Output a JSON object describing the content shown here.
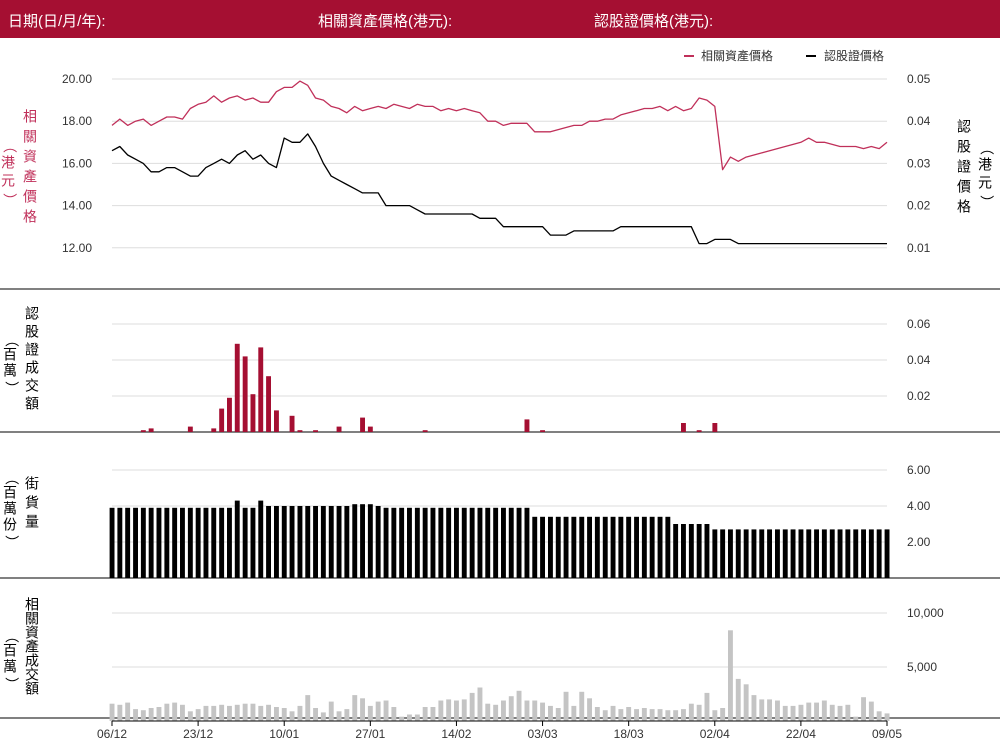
{
  "header": {
    "date_label": "日期(日/月/年):",
    "asset_price_label": "相關資產價格(港元):",
    "warrant_price_label": "認股證價格(港元):"
  },
  "colors": {
    "brand": "#a50f32",
    "asset_line": "#c0305a",
    "warrant_line": "#000000",
    "turnover_bar": "#a50f32",
    "outstanding_bar": "#000000",
    "asset_turnover_bar": "#c4c4c4",
    "grid": "#dddddd"
  },
  "chart_data": {
    "x_tick_labels": [
      "06/12",
      "23/12",
      "10/01",
      "27/01",
      "14/02",
      "03/03",
      "18/03",
      "02/04",
      "22/04",
      "09/05"
    ],
    "panels": [
      {
        "name": "price",
        "type": "line",
        "legend": [
          "相關資產價格",
          "認股證價格"
        ],
        "legend_position": "top-right",
        "left_axis_label": "相關資產價格（港元）",
        "right_axis_label": "認股證價格（港元）",
        "left_ticks": [
          "20.00",
          "18.00",
          "16.00",
          "14.00",
          "12.00"
        ],
        "right_ticks": [
          "0.05",
          "0.04",
          "0.03",
          "0.02",
          "0.01"
        ],
        "left_range": [
          12,
          20
        ],
        "right_range": [
          0.01,
          0.05
        ],
        "series": [
          {
            "name": "相關資產價格",
            "axis": "left",
            "values": [
              17.8,
              18.1,
              17.8,
              18.0,
              18.1,
              17.8,
              18.0,
              18.2,
              18.2,
              18.1,
              18.6,
              18.8,
              18.9,
              19.2,
              18.9,
              19.1,
              19.2,
              19.0,
              19.1,
              18.9,
              18.9,
              19.4,
              19.6,
              19.6,
              19.9,
              19.7,
              19.1,
              19.0,
              18.7,
              18.6,
              18.4,
              18.7,
              18.5,
              18.6,
              18.7,
              18.6,
              18.8,
              18.7,
              18.6,
              18.8,
              18.7,
              18.7,
              18.5,
              18.6,
              18.5,
              18.6,
              18.5,
              18.4,
              18.0,
              18.0,
              17.8,
              17.9,
              17.9,
              17.9,
              17.5,
              17.5,
              17.5,
              17.6,
              17.7,
              17.8,
              17.8,
              18.0,
              18.0,
              18.1,
              18.1,
              18.3,
              18.4,
              18.5,
              18.6,
              18.6,
              18.7,
              18.5,
              18.7,
              18.5,
              18.6,
              19.1,
              19.0,
              18.7,
              15.7,
              16.3,
              16.1,
              16.3,
              16.4,
              16.5,
              16.6,
              16.7,
              16.8,
              16.9,
              17.0,
              17.2,
              17.0,
              17.0,
              16.9,
              16.8,
              16.8,
              16.8,
              16.7,
              16.8,
              16.7,
              17.0
            ]
          },
          {
            "name": "認股證價格",
            "axis": "right",
            "values": [
              0.033,
              0.034,
              0.032,
              0.031,
              0.03,
              0.028,
              0.028,
              0.029,
              0.029,
              0.028,
              0.027,
              0.027,
              0.029,
              0.03,
              0.031,
              0.03,
              0.032,
              0.033,
              0.031,
              0.032,
              0.03,
              0.029,
              0.036,
              0.035,
              0.035,
              0.037,
              0.034,
              0.03,
              0.027,
              0.026,
              0.025,
              0.024,
              0.023,
              0.023,
              0.023,
              0.02,
              0.02,
              0.02,
              0.02,
              0.019,
              0.018,
              0.018,
              0.018,
              0.018,
              0.018,
              0.018,
              0.018,
              0.017,
              0.017,
              0.017,
              0.015,
              0.015,
              0.015,
              0.015,
              0.015,
              0.015,
              0.013,
              0.013,
              0.013,
              0.014,
              0.014,
              0.014,
              0.014,
              0.014,
              0.014,
              0.015,
              0.015,
              0.015,
              0.015,
              0.015,
              0.015,
              0.015,
              0.015,
              0.015,
              0.015,
              0.011,
              0.011,
              0.012,
              0.012,
              0.012,
              0.011,
              0.011,
              0.011,
              0.011,
              0.011,
              0.011,
              0.011,
              0.011,
              0.011,
              0.011,
              0.011,
              0.011,
              0.011,
              0.011,
              0.011,
              0.011,
              0.011,
              0.011,
              0.011,
              0.011
            ]
          }
        ]
      },
      {
        "name": "warrant_turnover",
        "type": "bar",
        "left_axis_label": "認股證成交額（百萬）",
        "right_ticks": [
          "0.06",
          "0.04",
          "0.02"
        ],
        "right_range": [
          0,
          0.07
        ],
        "values": [
          0,
          0,
          0,
          0,
          0.001,
          0.002,
          0,
          0,
          0,
          0,
          0.003,
          0,
          0,
          0.002,
          0.013,
          0.019,
          0.049,
          0.042,
          0.021,
          0.047,
          0.031,
          0.012,
          0,
          0.009,
          0.001,
          0,
          0.001,
          0,
          0,
          0.003,
          0,
          0,
          0.008,
          0.003,
          0,
          0,
          0,
          0,
          0,
          0,
          0.001,
          0,
          0,
          0,
          0,
          0,
          0,
          0,
          0,
          0,
          0,
          0,
          0,
          0.007,
          0,
          0.001,
          0,
          0,
          0,
          0,
          0,
          0,
          0,
          0,
          0,
          0,
          0,
          0,
          0,
          0,
          0,
          0,
          0,
          0.005,
          0,
          0.001,
          0,
          0.005,
          0,
          0,
          0,
          0,
          0,
          0,
          0,
          0,
          0,
          0,
          0,
          0,
          0,
          0,
          0,
          0,
          0,
          0,
          0,
          0,
          0,
          0
        ]
      },
      {
        "name": "outstanding",
        "type": "bar",
        "left_axis_label": "街貨量（百萬份）",
        "right_ticks": [
          "6.00",
          "4.00",
          "2.00"
        ],
        "right_range": [
          0,
          6.5
        ],
        "values": [
          3.9,
          3.9,
          3.9,
          3.9,
          3.9,
          3.9,
          3.9,
          3.9,
          3.9,
          3.9,
          3.9,
          3.9,
          3.9,
          3.9,
          3.9,
          3.9,
          4.3,
          3.9,
          3.9,
          4.3,
          4.0,
          4.0,
          4.0,
          4.0,
          4.0,
          4.0,
          4.0,
          4.0,
          4.0,
          4.0,
          4.0,
          4.1,
          4.1,
          4.1,
          4.0,
          3.9,
          3.9,
          3.9,
          3.9,
          3.9,
          3.9,
          3.9,
          3.9,
          3.9,
          3.9,
          3.9,
          3.9,
          3.9,
          3.9,
          3.9,
          3.9,
          3.9,
          3.9,
          3.9,
          3.4,
          3.4,
          3.4,
          3.4,
          3.4,
          3.4,
          3.4,
          3.4,
          3.4,
          3.4,
          3.4,
          3.4,
          3.4,
          3.4,
          3.4,
          3.4,
          3.4,
          3.4,
          3.0,
          3.0,
          3.0,
          3.0,
          3.0,
          2.7,
          2.7,
          2.7,
          2.7,
          2.7,
          2.7,
          2.7,
          2.7,
          2.7,
          2.7,
          2.7,
          2.7,
          2.7,
          2.7,
          2.7,
          2.7,
          2.7,
          2.7,
          2.7,
          2.7,
          2.7,
          2.7,
          2.7
        ]
      },
      {
        "name": "asset_turnover",
        "type": "bar",
        "left_axis_label": "相關資產成交額（百萬）",
        "right_ticks": [
          "10,000",
          "5,000"
        ],
        "right_range": [
          0,
          11500
        ],
        "values": [
          1600,
          1500,
          1700,
          1100,
          1000,
          1200,
          1300,
          1600,
          1700,
          1500,
          900,
          1100,
          1400,
          1400,
          1500,
          1400,
          1500,
          1600,
          1600,
          1400,
          1500,
          1300,
          1200,
          900,
          1400,
          2400,
          1200,
          800,
          1800,
          900,
          1100,
          2400,
          2100,
          1400,
          1800,
          1900,
          1300,
          400,
          600,
          600,
          1300,
          1300,
          1900,
          2000,
          1900,
          2000,
          2600,
          3100,
          1600,
          1500,
          1900,
          2300,
          2800,
          1900,
          1900,
          1700,
          1400,
          1200,
          2700,
          1400,
          2700,
          2100,
          1300,
          1000,
          1400,
          1100,
          1300,
          1100,
          1200,
          1100,
          1100,
          1000,
          1000,
          1100,
          1600,
          1500,
          2600,
          1000,
          1200,
          8400,
          3900,
          3400,
          2400,
          2000,
          2000,
          1900,
          1400,
          1400,
          1500,
          1700,
          1700,
          1900,
          1500,
          1400,
          1500,
          400,
          2200,
          1800,
          900,
          700
        ]
      }
    ]
  }
}
